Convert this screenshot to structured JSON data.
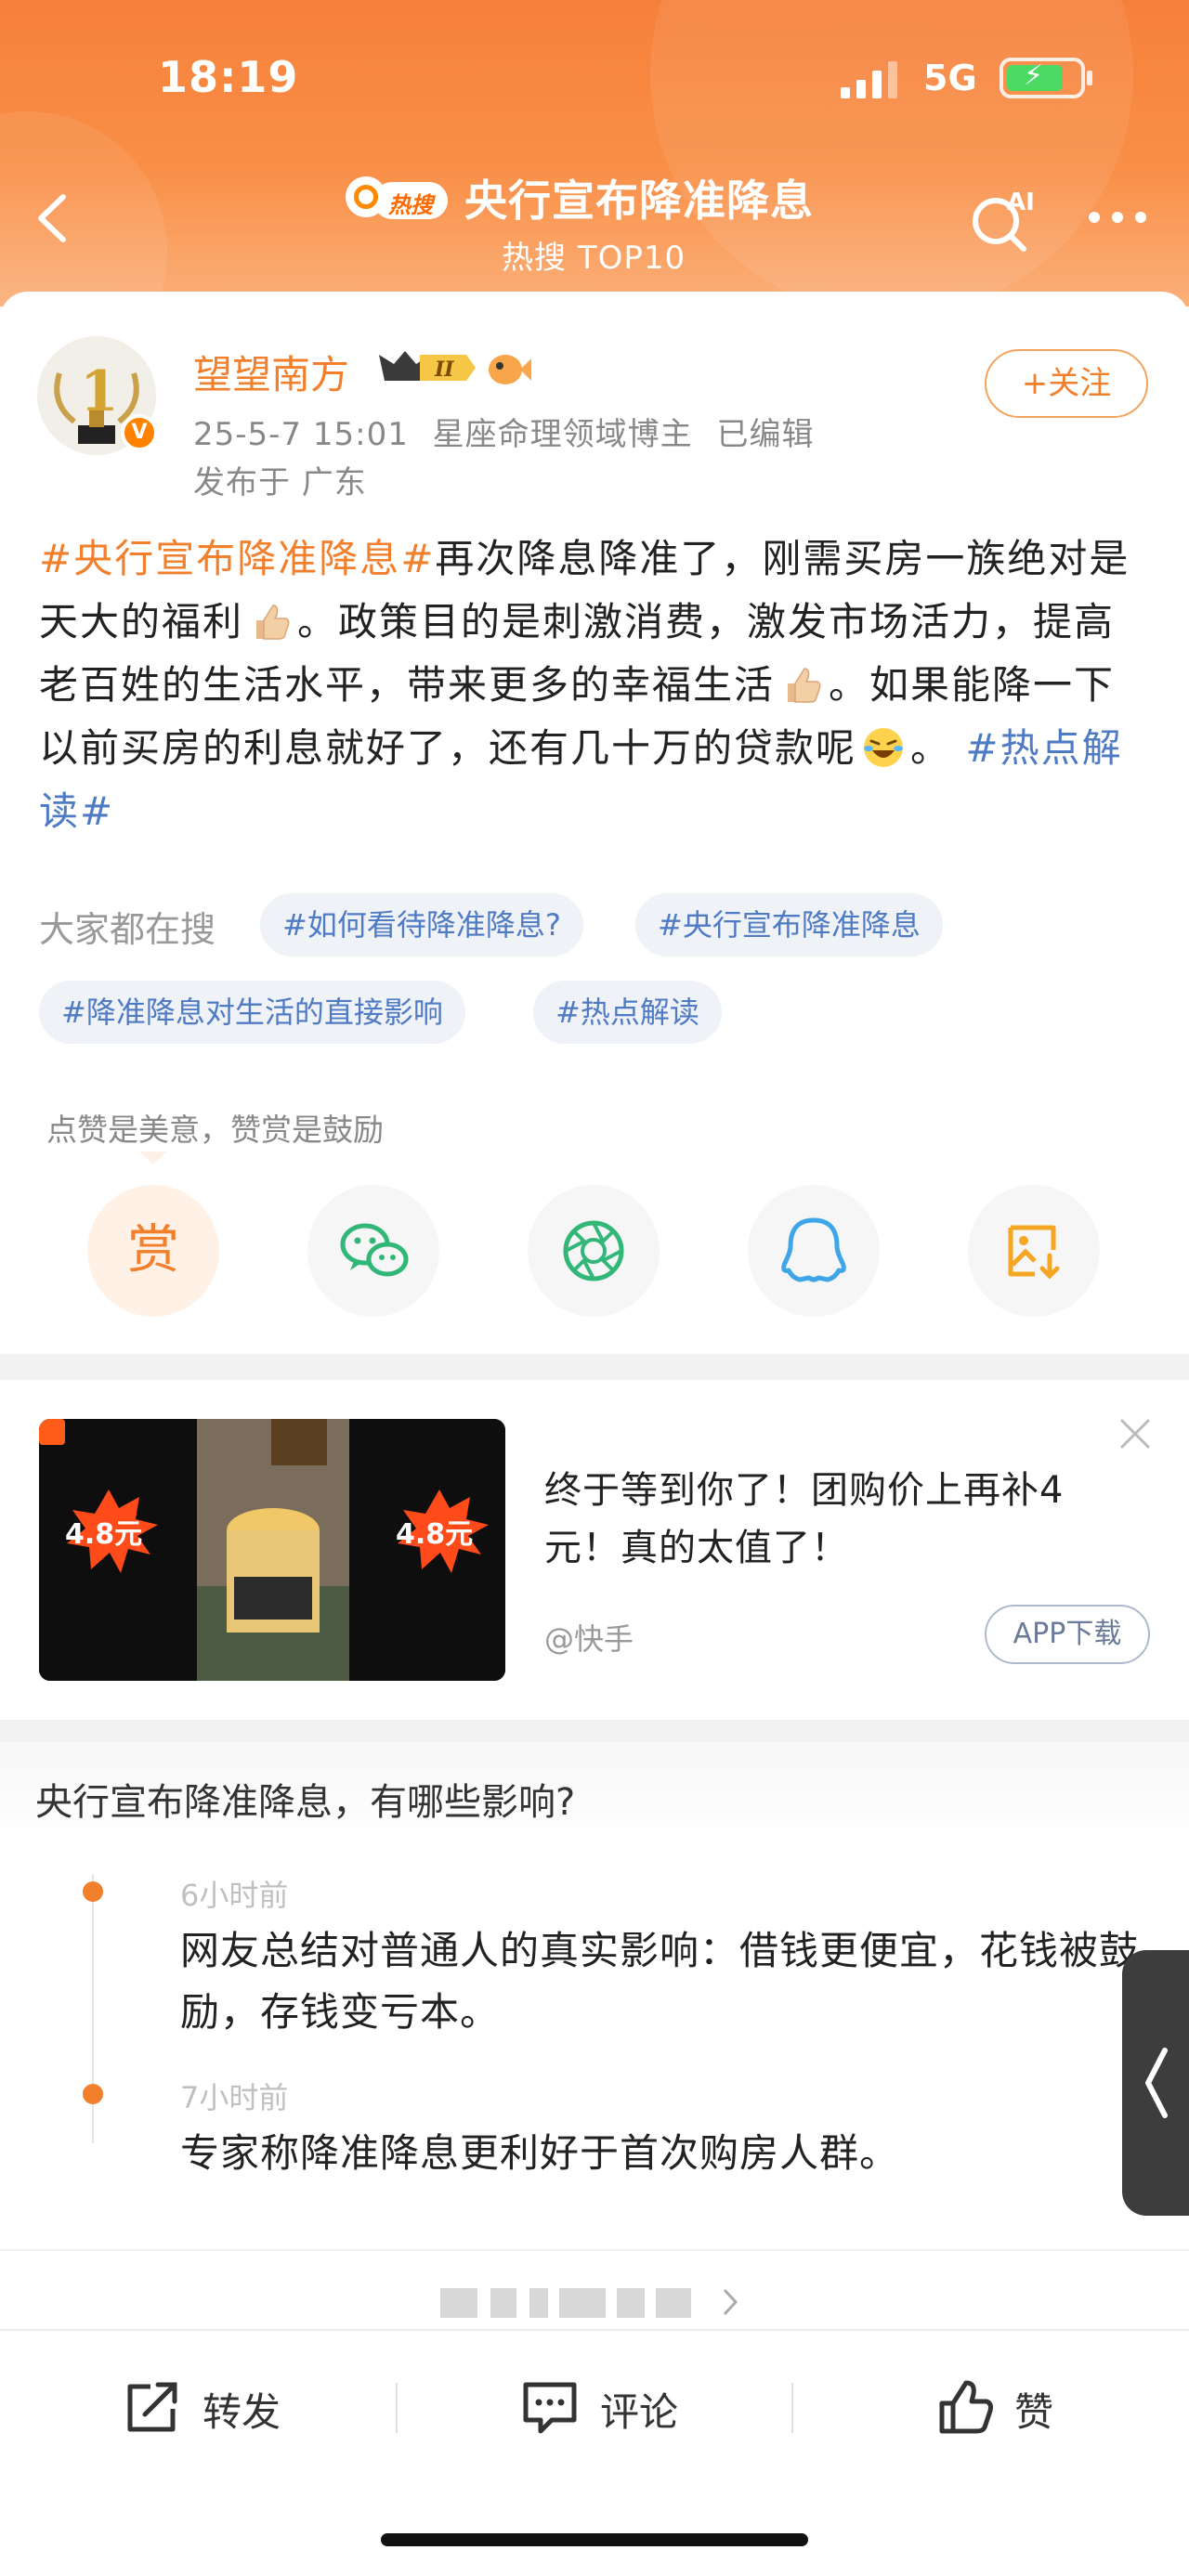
{
  "status_bar": {
    "time": "18:19",
    "network": "5G"
  },
  "header": {
    "hot_badge": "热搜",
    "title": "央行宣布降准降息",
    "subtitle": "热搜 TOP10"
  },
  "post": {
    "username": "望望南方",
    "level": "II",
    "time": "25-5-7 15:01",
    "field": "星座命理领域博主",
    "edited": "已编辑",
    "location": "发布于 广东",
    "follow_label": "+关注",
    "content": {
      "tag1": "#央行宣布降准降息#",
      "seg1": "再次降息降准了，刚需买房一族绝对是天大的福利",
      "seg2": "。政策目的是刺激消费，激发市场活力，提高老百姓的生活水平，带来更多的幸福生活",
      "seg3": "。如果能降一下以前买房的利息就好了，还有几十万的贷款呢",
      "seg4": "。 ",
      "tag2": "#热点解读#"
    },
    "everyone_searching_label": "大家都在搜",
    "search_chips": [
      "#如何看待降准降息?",
      "#央行宣布降准降息",
      "#降准降息对生活的直接影响",
      "#热点解读"
    ],
    "reward_hint": "点赞是美意，赞赏是鼓励",
    "reward_char": "赏",
    "share_icons": [
      "reward-icon",
      "wechat-icon",
      "moments-icon",
      "qq-icon",
      "save-image-icon"
    ]
  },
  "ad": {
    "price_tag": "4.8元",
    "text": "终于等到你了！团购价上再补4元！真的太值了！",
    "source": "@快手",
    "button": "APP下载"
  },
  "timeline": {
    "title": "央行宣布降准降息，有哪些影响?",
    "items": [
      {
        "time": "6小时前",
        "text": "网友总结对普通人的真实影响：借钱更便宜，花钱被鼓励，存钱变亏本。"
      },
      {
        "time": "7小时前",
        "text": "专家称降准降息更利好于首次购房人群。"
      }
    ]
  },
  "actions": {
    "repost": "转发",
    "comment": "评论",
    "like": "赞"
  },
  "colors": {
    "brand_orange": "#f27f2c",
    "tag_blue": "#4f7ac4"
  }
}
